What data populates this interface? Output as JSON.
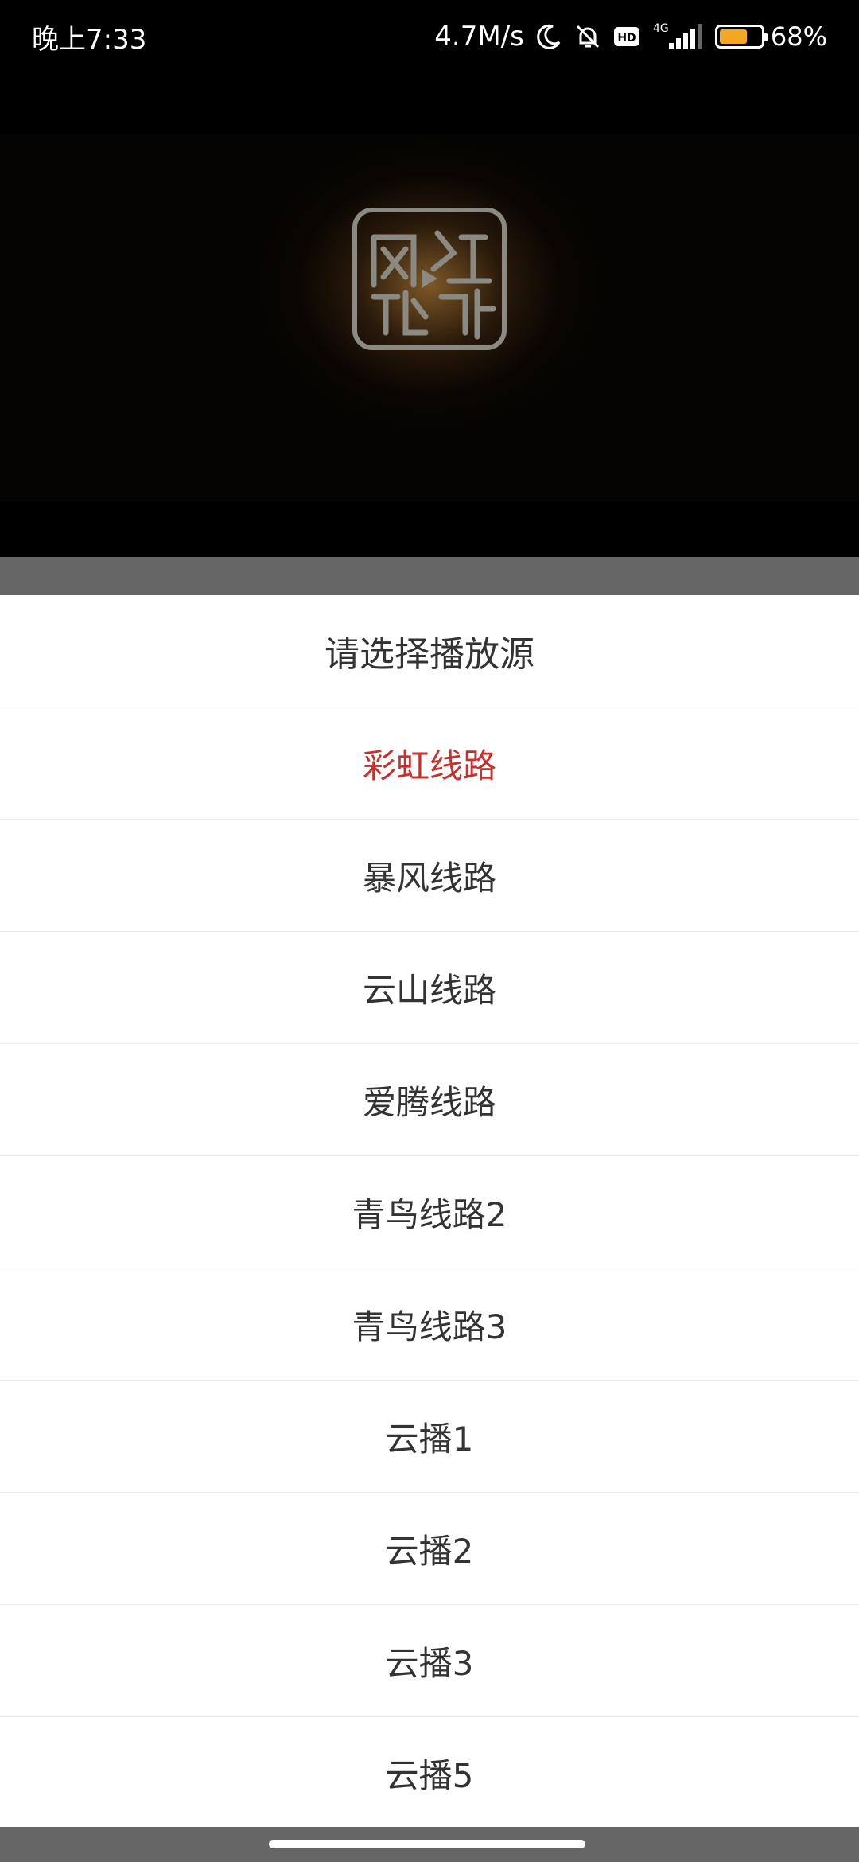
{
  "status_bar": {
    "time": "晚上7:33",
    "network_speed": "4.7M/s",
    "hd_label": "HD",
    "network_type": "4G",
    "battery_level": 0.68,
    "battery_text": "68%"
  },
  "video": {
    "logo_icon": "fengying-seal-logo"
  },
  "sheet": {
    "title": "请选择播放源",
    "options": [
      {
        "label": "彩虹线路",
        "selected": true
      },
      {
        "label": "暴风线路",
        "selected": false
      },
      {
        "label": "云山线路",
        "selected": false
      },
      {
        "label": "爱腾线路",
        "selected": false
      },
      {
        "label": "青鸟线路2",
        "selected": false
      },
      {
        "label": "青鸟线路3",
        "selected": false
      },
      {
        "label": "云播1",
        "selected": false
      },
      {
        "label": "云播2",
        "selected": false
      },
      {
        "label": "云播3",
        "selected": false
      },
      {
        "label": "云播5",
        "selected": false
      }
    ]
  },
  "colors": {
    "selected_text": "#c8302c",
    "normal_text": "#333333",
    "battery_fill": "#f5a623"
  }
}
